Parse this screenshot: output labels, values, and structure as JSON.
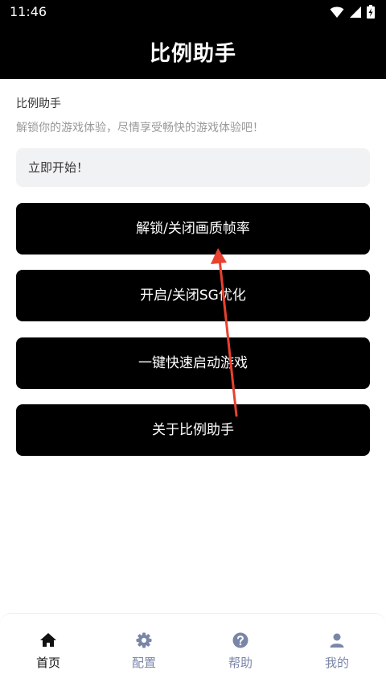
{
  "status_bar": {
    "time": "11:46"
  },
  "app_bar": {
    "title": "比例助手"
  },
  "intro": {
    "title": "比例助手",
    "description": "解锁你的游戏体验，尽情享受畅快的游戏体验吧！"
  },
  "start_box": {
    "label": "立即开始！"
  },
  "buttons": [
    {
      "label": "解锁/关闭画质帧率"
    },
    {
      "label": "开启/关闭SG优化"
    },
    {
      "label": "一键快速启动游戏"
    },
    {
      "label": "关于比例助手"
    }
  ],
  "bottom_nav": {
    "items": [
      {
        "label": "首页",
        "icon": "home-icon",
        "active": true
      },
      {
        "label": "配置",
        "icon": "gear-icon",
        "active": false
      },
      {
        "label": "帮助",
        "icon": "help-circle-icon",
        "active": false
      },
      {
        "label": "我的",
        "icon": "user-icon",
        "active": false
      }
    ]
  },
  "colors": {
    "app_bar_bg": "#000000",
    "button_bg": "#000000",
    "nav_active": "#111111",
    "nav_inactive": "#7a86a8",
    "annotation_arrow": "#e8412f"
  }
}
